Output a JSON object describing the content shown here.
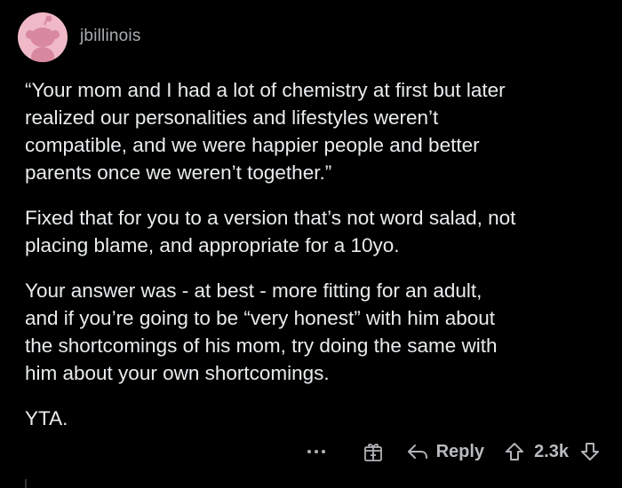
{
  "comment": {
    "author": "jbillinois",
    "paragraphs": [
      "“Your mom and I had a lot of chemistry at first but later\nrealized our personalities and lifestyles weren’t\ncompatible, and we were happier people and better\nparents once we weren’t together.”",
      "Fixed that for you to a version that’s not word salad, not\nplacing blame, and appropriate for a 10yo.",
      "Your answer was - at best - more fitting for an adult,\nand if you’re going to be “very honest” with him about\nthe shortcomings of his mom, try doing the same with\nhim about your own shortcomings.",
      "YTA."
    ],
    "actions": {
      "more_icon": "more-horizontal-icon",
      "award_icon": "gift-award-icon",
      "reply_icon": "reply-arrow-icon",
      "reply_label": "Reply",
      "upvote_icon": "upvote-arrow-icon",
      "vote_count": "2.3k",
      "downvote_icon": "downvote-arrow-icon"
    }
  },
  "colors": {
    "background": "#000000",
    "text": "#e9ecee",
    "muted": "#a9adb0",
    "avatar_bg": "#f0b9c8",
    "avatar_fg": "#d8889f"
  }
}
